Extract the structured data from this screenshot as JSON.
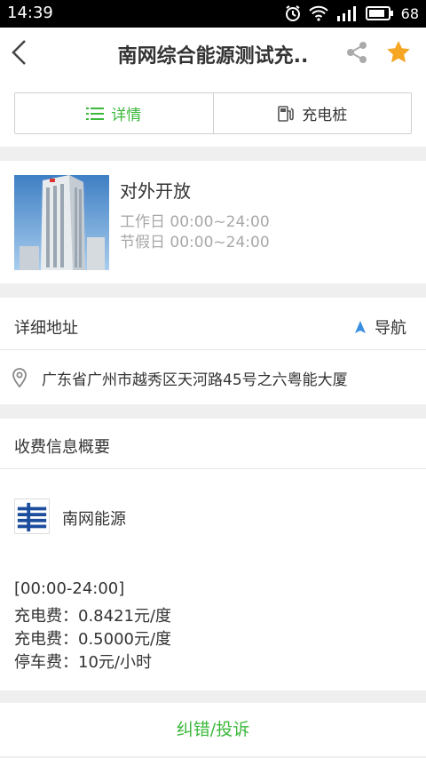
{
  "status_bar": {
    "time": "14:39",
    "battery": "68"
  },
  "header": {
    "title": "南网综合能源测试充..",
    "back_icon": "chevron-left-icon",
    "share_icon": "share-icon",
    "favorite_icon": "star-icon",
    "favorite_color": "#f5a623"
  },
  "tabs": [
    {
      "label": "详情",
      "icon": "list-icon",
      "active": true
    },
    {
      "label": "充电桩",
      "icon": "charging-pile-icon",
      "active": false
    }
  ],
  "station": {
    "open_status": "对外开放",
    "workday_hours": "工作日 00:00~24:00",
    "holiday_hours": "节假日 00:00~24:00"
  },
  "address": {
    "heading": "详细地址",
    "nav_label": "导航",
    "text": "广东省广州市越秀区天河路45号之六粤能大厦"
  },
  "fee": {
    "heading": "收费信息概要",
    "company": "南网能源",
    "time_range": "[00:00-24:00]",
    "charge_fee_1": "充电费：0.8421元/度",
    "charge_fee_2": "充电费：0.5000元/度",
    "parking_fee": "停车费：10元/小时"
  },
  "footer": {
    "report_label": "纠错/投诉"
  },
  "colors": {
    "accent_green": "#3cb83c",
    "nav_blue": "#3a8fe0"
  }
}
